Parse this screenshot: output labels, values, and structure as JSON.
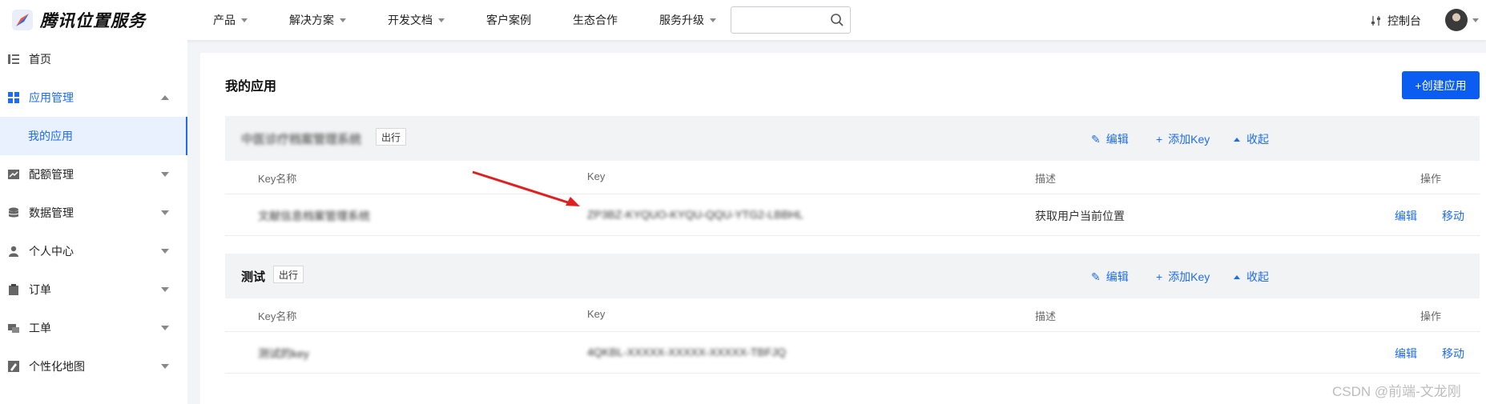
{
  "brand": {
    "name": "腾讯位置服务"
  },
  "nav": [
    {
      "label": "产品",
      "has_dropdown": true
    },
    {
      "label": "解决方案",
      "has_dropdown": true
    },
    {
      "label": "开发文档",
      "has_dropdown": true
    },
    {
      "label": "客户案例",
      "has_dropdown": false
    },
    {
      "label": "生态合作",
      "has_dropdown": false
    },
    {
      "label": "服务升级",
      "has_dropdown": true
    }
  ],
  "search": {
    "value": "",
    "placeholder": ""
  },
  "header": {
    "console_label": "控制台"
  },
  "sidebar": {
    "items": [
      {
        "label": "首页",
        "icon": "list-icon"
      },
      {
        "label": "应用管理",
        "icon": "grid-icon",
        "expanded": true
      },
      {
        "label": "我的应用",
        "sub": true,
        "active": true
      },
      {
        "label": "配额管理",
        "icon": "chart-icon"
      },
      {
        "label": "数据管理",
        "icon": "database-icon"
      },
      {
        "label": "个人中心",
        "icon": "user-icon"
      },
      {
        "label": "订单",
        "icon": "clipboard-icon"
      },
      {
        "label": "工单",
        "icon": "ticket-icon"
      },
      {
        "label": "个性化地图",
        "icon": "map-edit-icon"
      }
    ]
  },
  "main": {
    "title": "我的应用",
    "create_button": "+创建应用",
    "columns": {
      "key_name": "Key名称",
      "key": "Key",
      "desc": "描述",
      "ops": "操作"
    },
    "apps": [
      {
        "name": "中医诊疗档案管理系统",
        "tag": "出行",
        "actions": {
          "edit": "编辑",
          "add_key": "添加Key",
          "collapse": "收起"
        },
        "keys": [
          {
            "name": "文献信息档案管理系统",
            "key": "ZP3BZ-KYQUO-KYQU-QQU-YTG2-LBBHL",
            "desc": "获取用户当前位置",
            "edit": "编辑",
            "move": "移动"
          }
        ]
      },
      {
        "name": "测试",
        "tag": "出行",
        "actions": {
          "edit": "编辑",
          "add_key": "添加Key",
          "collapse": "收起"
        },
        "keys": [
          {
            "name": "测试的key",
            "key": "4QKBL-XXXXX-XXXXX-XXXXX-TBFJQ",
            "desc": "",
            "edit": "编辑",
            "move": "移动"
          }
        ]
      }
    ]
  },
  "watermark": "CSDN @前端-文龙刚",
  "colors": {
    "accent": "#1e6cf0",
    "primary_button": "#0a5df0",
    "annotation_arrow": "#e02020"
  }
}
